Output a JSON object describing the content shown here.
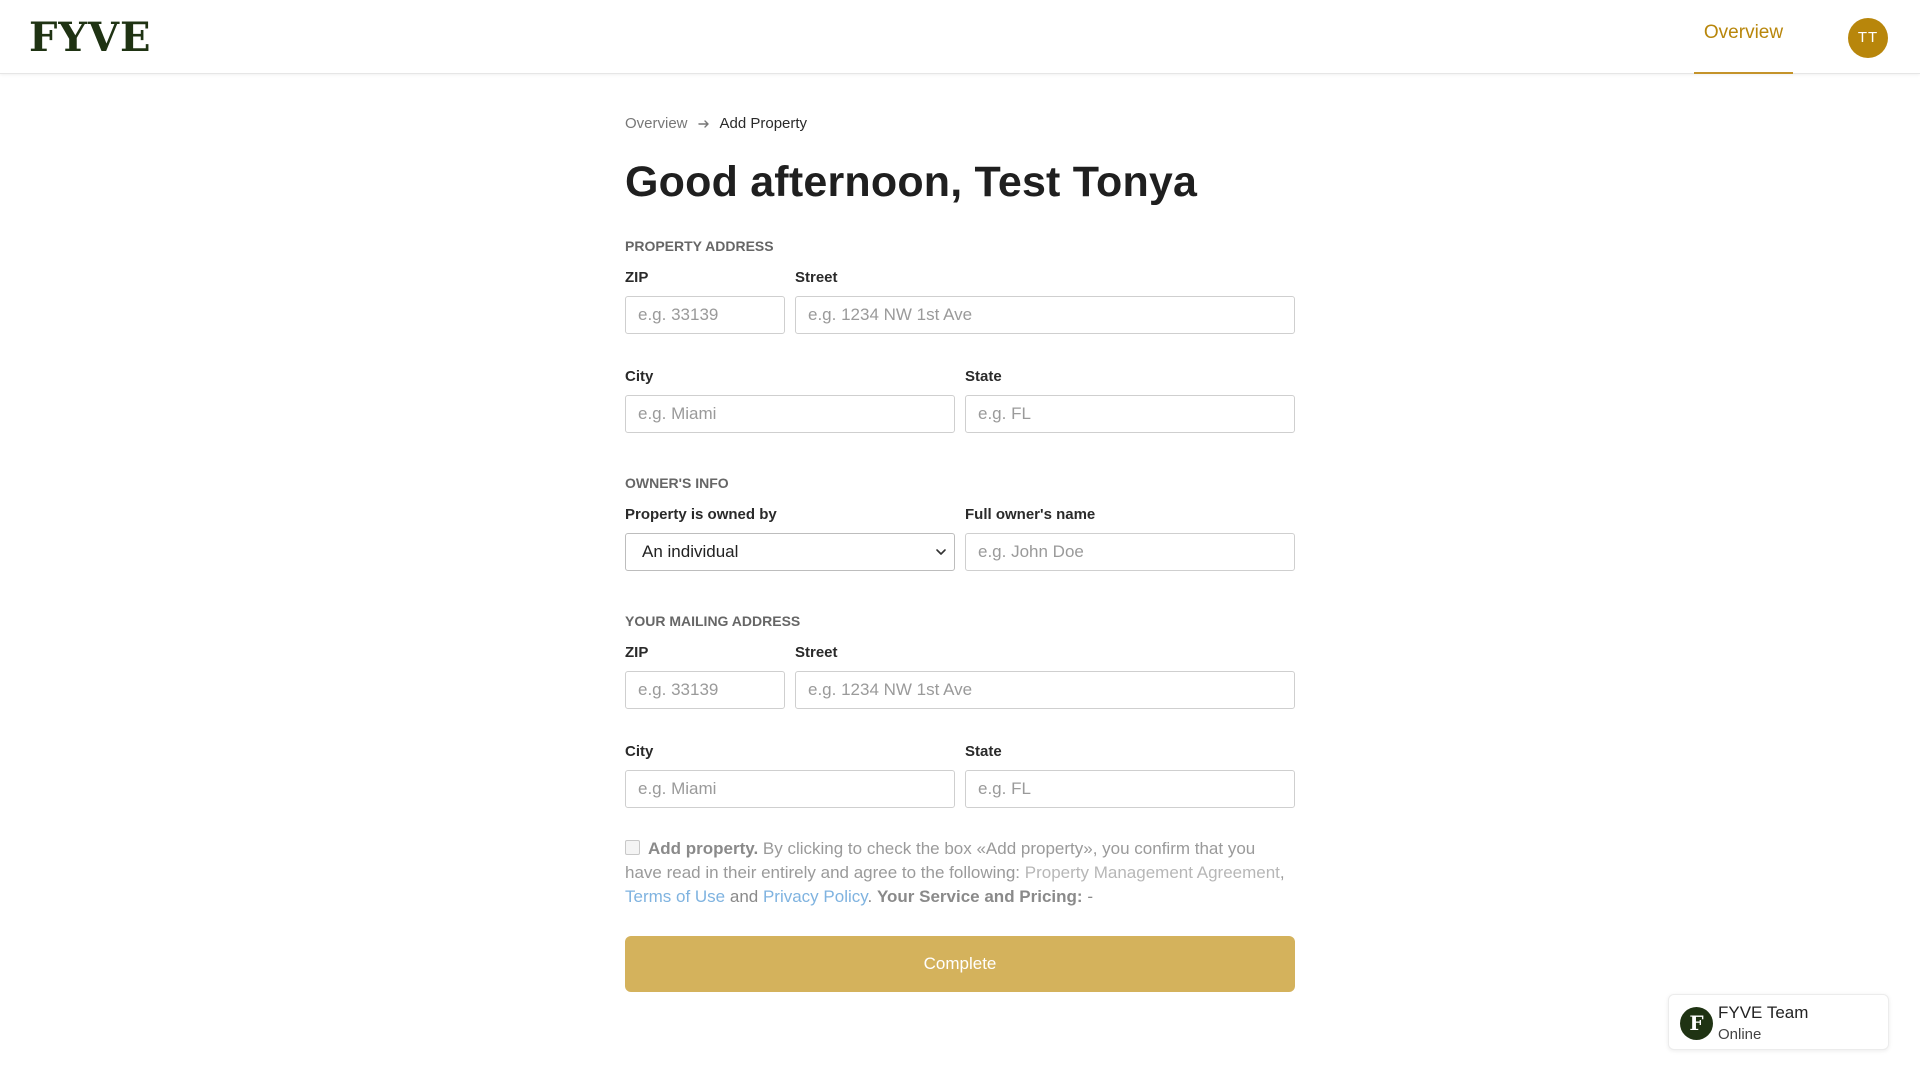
{
  "brand": {
    "logo_text": "FYVE",
    "accent": "#b8860b",
    "logo_color": "#1f3313"
  },
  "header": {
    "nav_overview": "Overview",
    "avatar_initials": "TT"
  },
  "breadcrumb": {
    "parent": "Overview",
    "current": "Add Property"
  },
  "page_title": "Good afternoon, Test Tonya",
  "property_address": {
    "section": "PROPERTY ADDRESS",
    "zip_label": "ZIP",
    "zip_placeholder": "e.g. 33139",
    "street_label": "Street",
    "street_placeholder": "e.g. 1234 NW 1st Ave",
    "city_label": "City",
    "city_placeholder": "e.g. Miami",
    "state_label": "State",
    "state_placeholder": "e.g. FL"
  },
  "owners_info": {
    "section": "OWNER'S INFO",
    "owned_by_label": "Property is owned by",
    "owned_by_value": "An individual",
    "owner_name_label": "Full owner's name",
    "owner_name_placeholder": "e.g. John Doe"
  },
  "mailing_address": {
    "section": "YOUR MAILING ADDRESS",
    "zip_label": "ZIP",
    "zip_placeholder": "e.g. 33139",
    "street_label": "Street",
    "street_placeholder": "e.g. 1234 NW 1st Ave",
    "city_label": "City",
    "city_placeholder": "e.g. Miami",
    "state_label": "State",
    "state_placeholder": "e.g. FL"
  },
  "consent": {
    "title": "Add property.",
    "text": " By clicking to check the box «Add property», you confirm that you have read in their entirely and agree to the following: ",
    "pma_link": "Property Management Agreement",
    "comma": ", ",
    "terms_link": "Terms of Use",
    "and": " and ",
    "privacy_link": "Privacy Policy",
    "period": ". ",
    "pricing_label": "Your Service and Pricing:",
    "pricing_value": " -"
  },
  "complete_button": "Complete",
  "chat": {
    "avatar_letter": "F",
    "name": "FYVE Team",
    "status": "Online"
  }
}
